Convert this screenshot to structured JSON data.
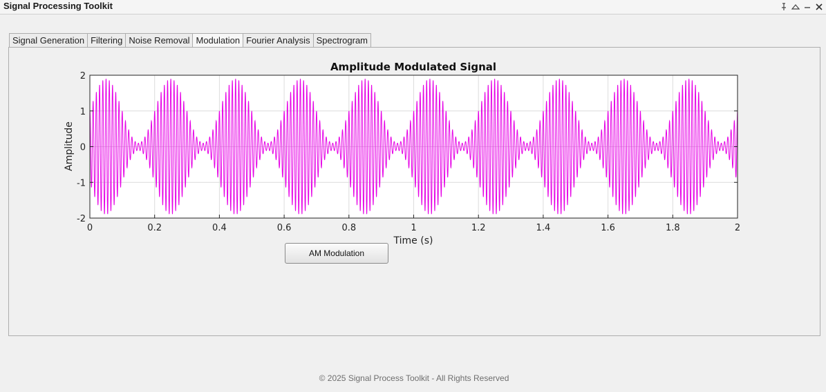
{
  "window": {
    "title": "Signal Processing Toolkit",
    "controls": [
      "pin-icon",
      "collapse-icon",
      "minimize-icon",
      "close-icon"
    ]
  },
  "tabs": [
    {
      "label": "Signal Generation",
      "active": false
    },
    {
      "label": "Filtering",
      "active": false
    },
    {
      "label": "Noise Removal",
      "active": false
    },
    {
      "label": "Modulation",
      "active": true
    },
    {
      "label": "Fourier Analysis",
      "active": false
    },
    {
      "label": "Spectrogram",
      "active": false
    }
  ],
  "chart_data": {
    "type": "line",
    "title": "Amplitude Modulated Signal",
    "xlabel": "Time (s)",
    "ylabel": "Amplitude",
    "xlim": [
      0,
      2
    ],
    "ylim": [
      -2,
      2
    ],
    "xticks": [
      "0",
      "0.2",
      "0.4",
      "0.6",
      "0.8",
      "1",
      "1.2",
      "1.4",
      "1.6",
      "1.8",
      "2"
    ],
    "yticks": [
      "2",
      "1",
      "0",
      "-1",
      "-2"
    ],
    "grid": true,
    "line_color": "#e600e6",
    "signal": {
      "carrier_frequency_hz": 100,
      "message_frequency_hz": 5,
      "carrier_amplitude": 1,
      "modulation_index": 0.9,
      "envelope_peaks_x": [
        0.05,
        0.25,
        0.45,
        0.65,
        0.85,
        1.05,
        1.25,
        1.45,
        1.65,
        1.85
      ],
      "envelope_peak_amplitude": 1.9,
      "envelope_min_amplitude": 0.1
    }
  },
  "actions": {
    "am_modulation_label": "AM Modulation"
  },
  "footer": {
    "text": "© 2025 Signal Process Toolkit - All Rights Reserved"
  },
  "colors": {
    "signal": "#e600e6",
    "grid": "#dcdcdc",
    "background": "#f0f0f0"
  }
}
